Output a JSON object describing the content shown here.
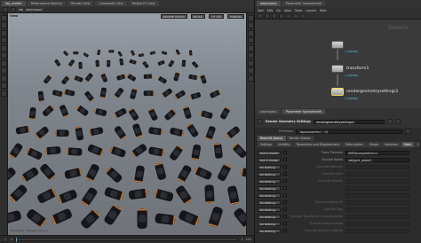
{
  "top_tabs": [
    "obj_scatter",
    "Performance Monitor",
    "Render View",
    "Composite View",
    "Motion FX View"
  ],
  "network_tabs": [
    "objectgeo1",
    "Parameter Spreadsheet"
  ],
  "path": {
    "context": "obj",
    "node": "objectgeo1"
  },
  "viewport": {
    "label": "View",
    "camera": "no cam",
    "options": [
      "Redshift (Alpha)",
      "Render",
      "Defaults"
    ],
    "instance_count": 120,
    "footer": "Unshaded - Default Camera"
  },
  "network": {
    "menus": [
      "Add",
      "Edit",
      "Go",
      "View",
      "Tools",
      "Layout",
      "Help"
    ],
    "watermark": "Solaris",
    "nodes": [
      {
        "name": "",
        "sub": "c_rsproxy",
        "selected": false
      },
      {
        "name": "transform1",
        "sub": "c_rsproxy",
        "selected": false
      },
      {
        "name": "rendergeometrysettings1",
        "sub": "c_rsproxy",
        "selected": true
      }
    ]
  },
  "params": {
    "node_type": "Render Geometry Settings",
    "node_name": "rendergeometrysettings1",
    "primitives_label": "Primitives",
    "primitives_value": "`lopinputprims('.', 0)`",
    "tabs": [
      "Redshift (Alpha)",
      "Render Globals"
    ],
    "subtabs": [
      "Settings",
      "Visibility",
      "Tessellation and Displacement",
      "Deformation",
      "Shape",
      "Instances",
      "Mesh",
      "Shadow",
      "Merge"
    ],
    "rows": [
      {
        "button": "Set or Create",
        "label": "Proxy Filename",
        "value": "$HIP/proxy/boltcar.rs",
        "dimmed": false
      },
      {
        "button": "Set or Create",
        "label": "Exclude Nodes",
        "value": "/obj/grid_object1",
        "dimmed": false
      },
      {
        "button": "Do Nothing",
        "label": "Override Materials",
        "value": "",
        "dimmed": true
      },
      {
        "button": "Do Nothing",
        "label": "Override Lights",
        "value": "",
        "dimmed": true
      },
      {
        "button": "Do Nothing",
        "label": "Override Visibility",
        "value": "",
        "dimmed": true
      },
      {
        "button": "Do Nothing",
        "label": "",
        "value": "",
        "dimmed": true
      },
      {
        "button": "Do Nothing",
        "label": "",
        "value": "",
        "dimmed": true
      },
      {
        "button": "Do Nothing",
        "label": "Override Objects ID",
        "value": "",
        "dimmed": true
      },
      {
        "button": "Do Nothing",
        "label": "Override Tags",
        "value": "",
        "dimmed": true
      },
      {
        "button": "Do Nothing",
        "label": "Override Tessellation & Displacement",
        "value": "",
        "dimmed": true
      },
      {
        "button": "Do Nothing",
        "label": "Override Matte Shadow",
        "value": "",
        "dimmed": true
      },
      {
        "button": "Do Nothing",
        "label": "Override Primitive Visibility",
        "value": "",
        "dimmed": true
      }
    ]
  },
  "timeline": {
    "start": "1",
    "end": "240",
    "current": "1"
  },
  "colors": {
    "accent": "#f2d25a",
    "link": "#67b7e0",
    "bg": "#2b2b2b",
    "floor": "#6f7379"
  }
}
